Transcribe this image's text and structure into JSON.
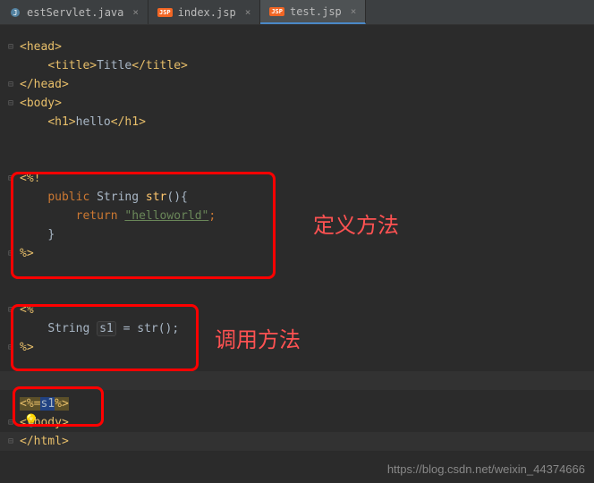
{
  "tabs": [
    {
      "label": "estServlet.java",
      "type": "java"
    },
    {
      "label": "index.jsp",
      "type": "jsp"
    },
    {
      "label": "test.jsp",
      "type": "jsp",
      "active": true
    }
  ],
  "code": {
    "head_open": "<head>",
    "title_open": "<title>",
    "title_text": "Title",
    "title_close": "</title>",
    "head_close": "</head>",
    "body_open": "<body>",
    "h1_open": "<h1>",
    "h1_text": "hello",
    "h1_close": "</h1>",
    "jsp_decl_open": "<%!",
    "public": "public",
    "string_type": "String",
    "method_name": "str",
    "paren_brace": "(){",
    "return": "return",
    "string_val": "\"helloworld\"",
    "semicolon": ";",
    "brace_close": "}",
    "jsp_close": "%>",
    "jsp_open": "<%",
    "var_decl_type": "String",
    "var_name": "s1",
    "equals": " = ",
    "call": "str();",
    "expr_open": "<%=",
    "expr_var": "s1",
    "expr_close": "%>",
    "body_close": "</body>",
    "html_close": "</html>"
  },
  "annotations": {
    "define": "定义方法",
    "call": "调用方法"
  },
  "jsp_badge": "JSP",
  "watermark": "https://blog.csdn.net/weixin_44374666"
}
